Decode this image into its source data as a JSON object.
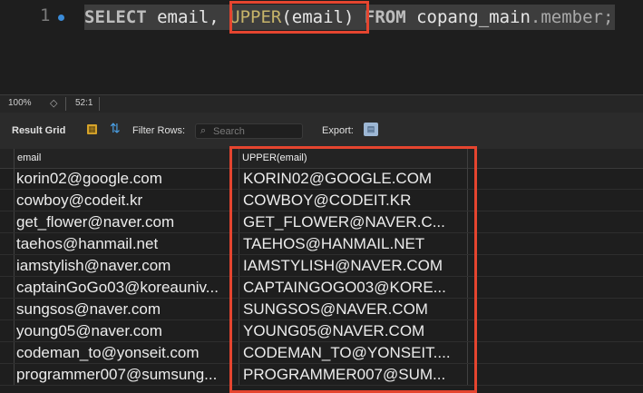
{
  "editor": {
    "line_number": "1",
    "sql": {
      "keyword_select": "SELECT",
      "col_text": " email, ",
      "func_name": "UPPER",
      "func_arg": "(email)",
      "keyword_from": " FROM ",
      "schema": "copang_main",
      "dot_table": ".member;"
    }
  },
  "status_bar": {
    "zoom": "100%",
    "zoom_stepper_glyph": "◇",
    "cursor_position": "52:1"
  },
  "toolbar": {
    "result_grid_label": "Result Grid",
    "filter_rows_label": "Filter Rows:",
    "search_placeholder": "Search",
    "export_label": "Export:"
  },
  "grid": {
    "columns": [
      "email",
      "UPPER(email)"
    ],
    "rows": [
      [
        "korin02@google.com",
        "KORIN02@GOOGLE.COM"
      ],
      [
        "cowboy@codeit.kr",
        "COWBOY@CODEIT.KR"
      ],
      [
        "get_flower@naver.com",
        "GET_FLOWER@NAVER.C..."
      ],
      [
        "taehos@hanmail.net",
        "TAEHOS@HANMAIL.NET"
      ],
      [
        "iamstylish@naver.com",
        "IAMSTYLISH@NAVER.COM"
      ],
      [
        "captainGoGo03@koreauniv...",
        "CAPTAINGOGO03@KORE..."
      ],
      [
        "sungsos@naver.com",
        "SUNGSOS@NAVER.COM"
      ],
      [
        "young05@naver.com",
        "YOUNG05@NAVER.COM"
      ],
      [
        "codeman_to@yonseit.com",
        "CODEMAN_TO@YONSEIT...."
      ],
      [
        "programmer007@sumsung...",
        "PROGRAMMER007@SUM..."
      ]
    ]
  },
  "colors": {
    "highlight": "#e5452f",
    "editor_bg": "#1e1e1e",
    "function": "#c6b46a"
  }
}
